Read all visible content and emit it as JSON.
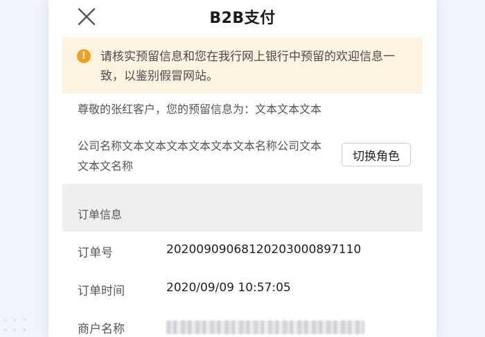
{
  "header": {
    "title": "B2B支付",
    "close_icon": "close-icon"
  },
  "notice": {
    "icon": "exclamation-icon",
    "accent": "#f0a020",
    "background": "#fdf3e1",
    "text": "请核实预留信息和您在我行网上银行中预留的欢迎信息一致，以鉴别假冒网站。"
  },
  "greeting": {
    "prefix": "尊敬的张红客户，您的预留信息为：",
    "value": "文本文本文本"
  },
  "company": {
    "name": "公司名称文本文本文本文本文本文本名称公司文本文本文名称",
    "switch_label": "切换角色"
  },
  "order": {
    "section_title": "订单信息",
    "fields": [
      {
        "label": "订单号",
        "value": "20200909068120203000897110"
      },
      {
        "label": "订单时间",
        "value": "2020/09/09  10:57:05"
      },
      {
        "label": "商户名称",
        "value": ""
      }
    ]
  }
}
